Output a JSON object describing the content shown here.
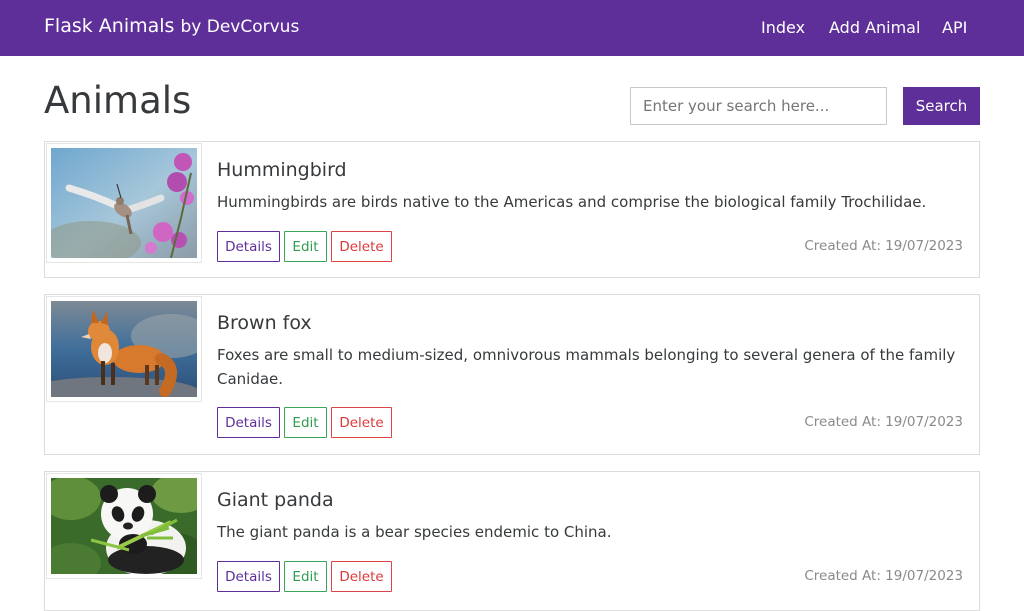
{
  "navbar": {
    "brand": "Flask Animals",
    "brand_by": "by DevCorvus",
    "links": [
      "Index",
      "Add Animal",
      "API"
    ]
  },
  "page": {
    "title": "Animals"
  },
  "search": {
    "placeholder": "Enter your search here...",
    "button_label": "Search"
  },
  "labels": {
    "details": "Details",
    "edit": "Edit",
    "delete": "Delete"
  },
  "animals": [
    {
      "name": "Hummingbird",
      "description": "Hummingbirds are birds native to the Americas and comprise the biological family Trochilidae.",
      "created_at": "Created At: 19/07/2023"
    },
    {
      "name": "Brown fox",
      "description": "Foxes are small to medium-sized, omnivorous mammals belonging to several genera of the family Canidae.",
      "created_at": "Created At: 19/07/2023"
    },
    {
      "name": "Giant panda",
      "description": "The giant panda is a bear species endemic to China.",
      "created_at": "Created At: 19/07/2023"
    }
  ],
  "colors": {
    "primary": "#5e2f99",
    "success": "#2e9e4e",
    "danger": "#d83b3b"
  }
}
